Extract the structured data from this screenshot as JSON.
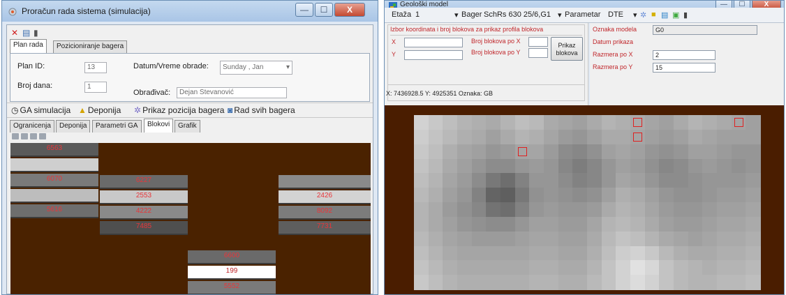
{
  "win1": {
    "title": "Proračun rada sistema (simulacija)",
    "controls": {
      "minimize": "—",
      "maximize": "☐",
      "close": "X"
    },
    "toolbar": {
      "delete_icon": "✕",
      "save_icon": "▤",
      "info_icon": "▮"
    },
    "top_tabs": [
      "Plan rada",
      "Pozicioniranje bagera"
    ],
    "form": {
      "plan_id_label": "Plan ID:",
      "plan_id_value": "13",
      "datetime_label": "Datum/Vreme obrade:",
      "datetime_day": "Sunday",
      "datetime_month": "Jan",
      "broj_dana_label": "Broj dana:",
      "broj_dana_value": "1",
      "obradivac_label": "Obrađivač:",
      "obradivac_value": "Dejan Stevanović"
    },
    "actions": [
      "GA simulacija",
      "Deponija",
      "Prikaz pozicija bagera",
      "Rad svih bagera"
    ],
    "sub_tabs": [
      "Ogranicenja",
      "Deponija",
      "Parametri GA",
      "Blokovi",
      "Grafik"
    ],
    "active_sub_tab": "Blokovi",
    "columns": [
      {
        "blocks": [
          {
            "value": "6563",
            "shade": "#5a5a5a"
          },
          {
            "value": "",
            "shade": "#cfcfcf"
          },
          {
            "value": "6070",
            "shade": "#7a7a7a"
          },
          {
            "value": "",
            "shade": "#bdbdbd"
          },
          {
            "value": "5616",
            "shade": "#6e6e6e"
          }
        ]
      },
      {
        "blocks": [
          {
            "value": "6227",
            "shade": "#6a6a6a"
          },
          {
            "value": "2553",
            "shade": "#c9c9c9"
          },
          {
            "value": "4222",
            "shade": "#8a8a8a"
          },
          {
            "value": "7485",
            "shade": "#4f4f4f"
          }
        ]
      },
      {
        "blocks": [
          {
            "value": "6600",
            "shade": "#6a6a6a"
          },
          {
            "value": "199",
            "shade": "#ffffff"
          },
          {
            "value": "5552",
            "shade": "#7a7a7a"
          }
        ]
      },
      {
        "blocks": [
          {
            "value": "",
            "shade": "#8a8a8a"
          },
          {
            "value": "2426",
            "shade": "#d3d3d3"
          },
          {
            "value": "8092",
            "shade": "#7c7c7c"
          },
          {
            "value": "7731",
            "shade": "#5e5e5e"
          }
        ]
      }
    ]
  },
  "win2": {
    "title": "Geološki model",
    "controls": {
      "minimize": "—",
      "maximize": "☐",
      "close": "X"
    },
    "toolbar": {
      "etaza_label": "Etaža",
      "etaza_value": "1",
      "bager_label": "Bager",
      "bager_value": "SchRs 630 25/6,G1",
      "parametar_label": "Parametar",
      "parametar_value": "DTE"
    },
    "panel_left": {
      "header": "Izbor koordinata i broj blokova za prikaz profila blokova",
      "x_label": "X",
      "y_label": "Y",
      "broj_x_label": "Broj blokova po X",
      "broj_y_label": "Broj blokova po Y",
      "button": "Prikaz blokova",
      "status": "X: 7436928.5 Y: 4925351 Oznaka: GB"
    },
    "panel_right": {
      "oznaka_label": "Oznaka modela",
      "oznaka_value": "G0",
      "datum_label": "Datum prikaza",
      "razmera_x_label": "Razmera po X",
      "razmera_x_value": "2",
      "razmera_y_label": "Razmera po Y",
      "razmera_y_value": "15"
    },
    "heatmap_rows": [
      [
        210,
        200,
        190,
        180,
        175,
        170,
        180,
        190,
        185,
        170,
        165,
        160,
        170,
        180,
        175,
        170,
        165,
        160,
        170,
        180,
        175,
        170,
        165,
        160
      ],
      [
        205,
        195,
        185,
        175,
        170,
        160,
        170,
        180,
        175,
        165,
        155,
        150,
        160,
        170,
        170,
        165,
        160,
        155,
        160,
        170,
        165,
        160,
        160,
        160
      ],
      [
        200,
        190,
        175,
        165,
        160,
        150,
        155,
        165,
        165,
        155,
        140,
        135,
        145,
        160,
        165,
        160,
        150,
        145,
        150,
        160,
        160,
        155,
        150,
        150
      ],
      [
        195,
        185,
        170,
        160,
        150,
        140,
        140,
        150,
        155,
        150,
        135,
        125,
        135,
        150,
        160,
        155,
        145,
        135,
        140,
        150,
        155,
        150,
        145,
        150
      ],
      [
        190,
        180,
        165,
        155,
        140,
        120,
        110,
        130,
        150,
        150,
        140,
        130,
        135,
        150,
        165,
        160,
        150,
        140,
        140,
        145,
        150,
        150,
        150,
        155
      ],
      [
        185,
        175,
        160,
        150,
        130,
        100,
        95,
        120,
        145,
        150,
        145,
        140,
        145,
        160,
        175,
        170,
        160,
        150,
        145,
        145,
        150,
        155,
        155,
        160
      ],
      [
        180,
        170,
        155,
        145,
        135,
        115,
        110,
        130,
        150,
        155,
        150,
        150,
        155,
        170,
        180,
        175,
        165,
        155,
        150,
        150,
        155,
        160,
        160,
        165
      ],
      [
        180,
        170,
        160,
        150,
        145,
        140,
        140,
        150,
        160,
        160,
        155,
        155,
        165,
        180,
        185,
        180,
        170,
        160,
        155,
        155,
        160,
        165,
        165,
        170
      ],
      [
        185,
        175,
        165,
        160,
        155,
        155,
        155,
        160,
        165,
        165,
        160,
        160,
        170,
        185,
        195,
        190,
        180,
        170,
        165,
        160,
        165,
        170,
        170,
        175
      ],
      [
        190,
        180,
        170,
        165,
        165,
        165,
        165,
        165,
        170,
        170,
        165,
        165,
        175,
        190,
        205,
        210,
        200,
        185,
        175,
        170,
        170,
        175,
        175,
        180
      ],
      [
        195,
        185,
        175,
        170,
        170,
        170,
        170,
        170,
        175,
        175,
        170,
        170,
        180,
        195,
        210,
        225,
        215,
        195,
        185,
        180,
        175,
        180,
        180,
        185
      ],
      [
        200,
        190,
        180,
        175,
        175,
        175,
        175,
        175,
        180,
        180,
        175,
        175,
        185,
        195,
        210,
        220,
        210,
        195,
        185,
        180,
        180,
        185,
        185,
        190
      ]
    ],
    "markers": [
      {
        "col": 7,
        "row": 2
      },
      {
        "col": 15,
        "row": 0
      },
      {
        "col": 15,
        "row": 1
      },
      {
        "col": 22,
        "row": 0
      }
    ]
  }
}
